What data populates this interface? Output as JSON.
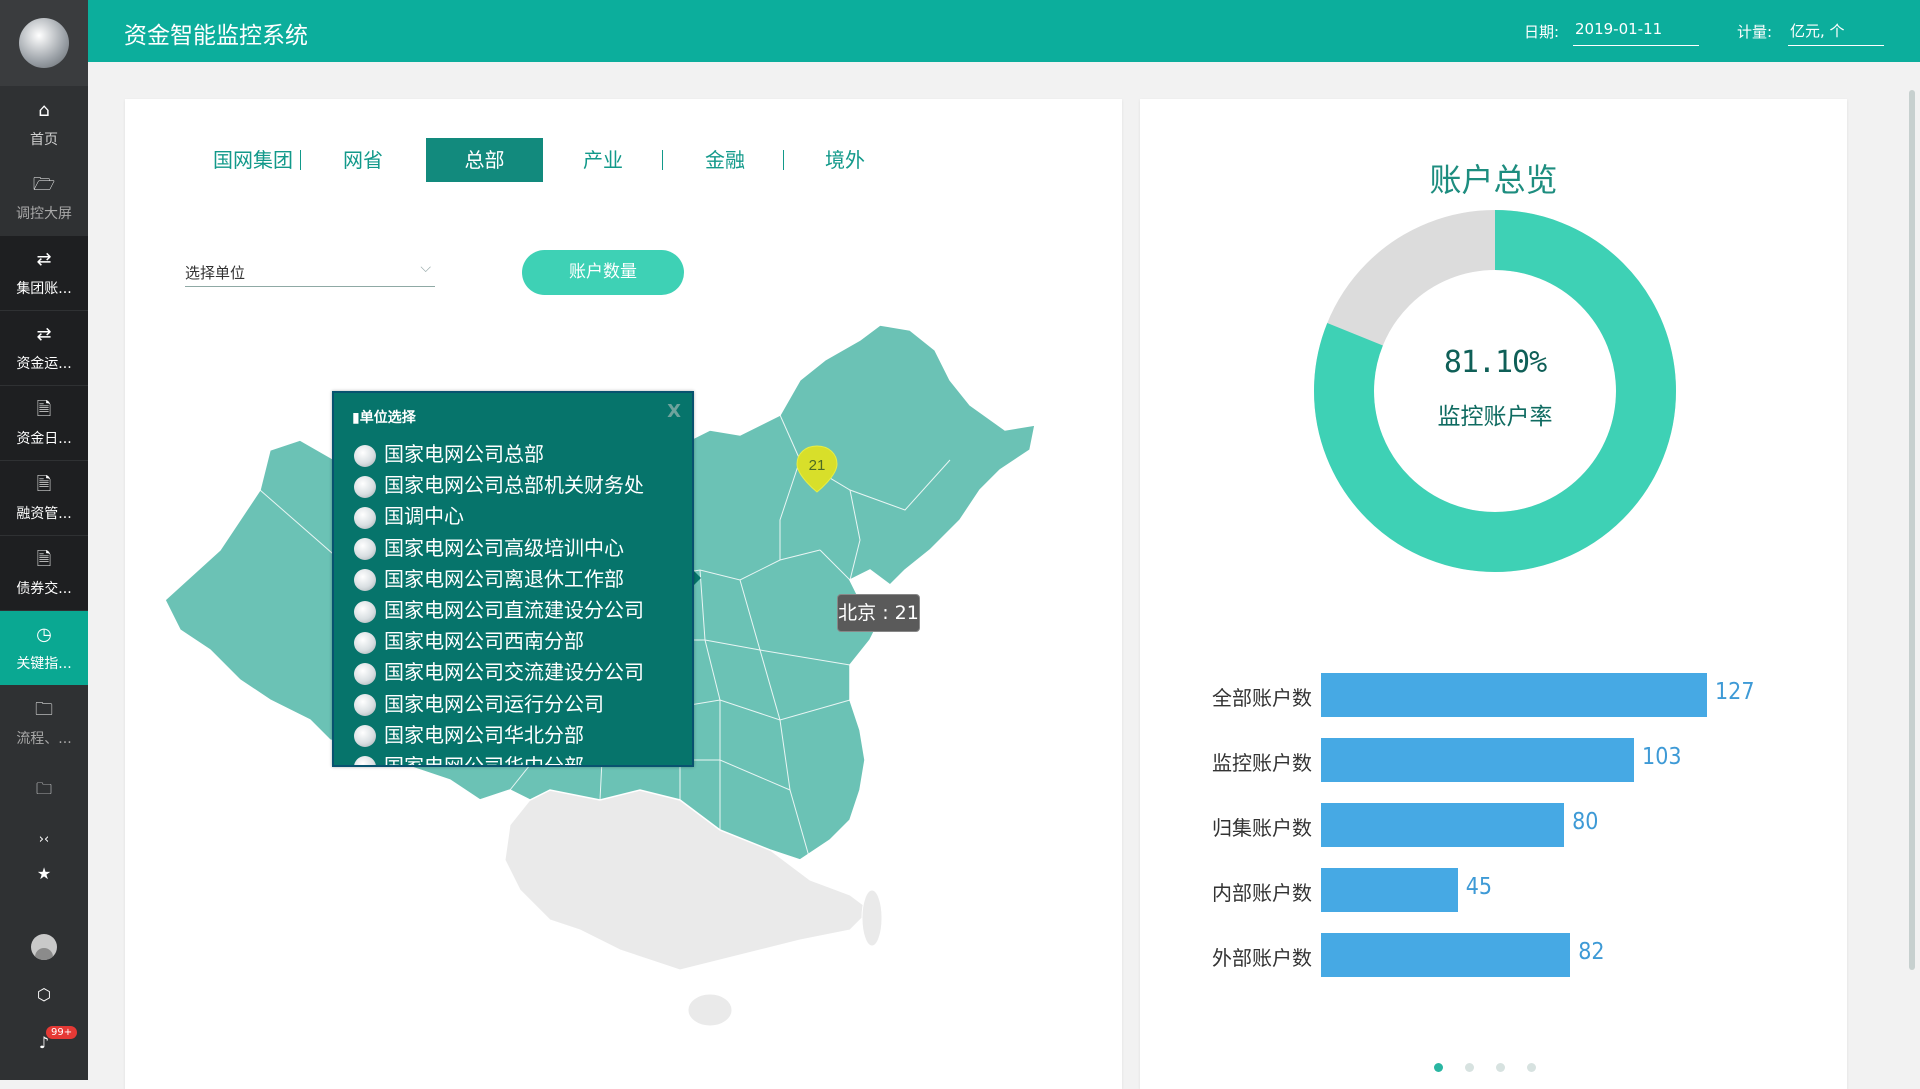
{
  "app": {
    "title": "资金智能监控系统"
  },
  "header": {
    "date_label": "日期:",
    "date_value": "2019-01-11",
    "unit_label": "计量:",
    "unit_value": "亿元, 个"
  },
  "sidebar": {
    "items": [
      {
        "label": "首页",
        "icon": "home-icon"
      },
      {
        "label": "调控大屏",
        "icon": "folder-open-icon"
      },
      {
        "label": "集团账...",
        "icon": "money-cycle-icon"
      },
      {
        "label": "资金运...",
        "icon": "money-cycle-icon"
      },
      {
        "label": "资金日...",
        "icon": "document-icon"
      },
      {
        "label": "融资管...",
        "icon": "document-icon"
      },
      {
        "label": "债券交...",
        "icon": "document-icon"
      },
      {
        "label": "关键指...",
        "icon": "gauge-icon"
      },
      {
        "label": "流程、...",
        "icon": "folder-icon"
      },
      {
        "label": "",
        "icon": "folder-icon"
      }
    ],
    "notifications": "99+"
  },
  "tabs": [
    "国网集团",
    "网省",
    "总部",
    "产业",
    "金融",
    "境外"
  ],
  "active_tab": "总部",
  "filter": {
    "placeholder": "选择单位",
    "button": "账户数量"
  },
  "popup": {
    "title": "单位选择",
    "close": "X",
    "items": [
      "国家电网公司总部",
      "国家电网公司总部机关财务处",
      "国调中心",
      "国家电网公司高级培训中心",
      "国家电网公司离退休工作部",
      "国家电网公司直流建设分公司",
      "国家电网公司西南分部",
      "国家电网公司交流建设分公司",
      "国家电网公司运行分公司",
      "国家电网公司华北分部",
      "国家电网公司华中分部"
    ]
  },
  "map": {
    "marker_value": "21",
    "tooltip": "北京 : 21"
  },
  "overview": {
    "title": "账户总览",
    "rate_value": "81.10%",
    "rate_label": "监控账户率",
    "rate_fraction": 0.811
  },
  "chart_data": {
    "type": "bar",
    "categories": [
      "全部账户数",
      "监控账户数",
      "归集账户数",
      "内部账户数",
      "外部账户数"
    ],
    "values": [
      127,
      103,
      80,
      45,
      82
    ]
  },
  "pagination": {
    "count": 4,
    "active": 0
  },
  "colors": {
    "header": "#0cae9c",
    "accent": "#3ed1b5",
    "map_region": "#6bc2b5",
    "bar": "#46a9e4"
  }
}
